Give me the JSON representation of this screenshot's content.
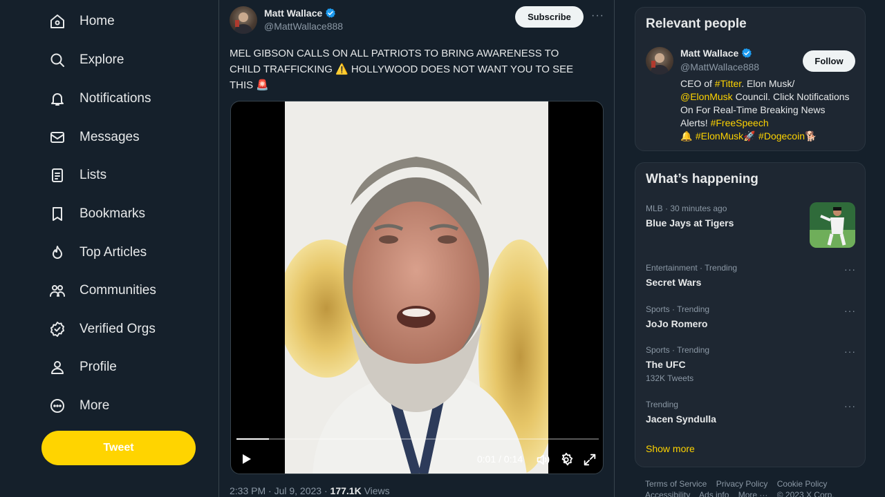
{
  "sidebar": {
    "items": [
      {
        "label": "Home",
        "icon": "home-icon"
      },
      {
        "label": "Explore",
        "icon": "search-icon"
      },
      {
        "label": "Notifications",
        "icon": "bell-icon"
      },
      {
        "label": "Messages",
        "icon": "mail-icon"
      },
      {
        "label": "Lists",
        "icon": "list-icon"
      },
      {
        "label": "Bookmarks",
        "icon": "bookmark-icon"
      },
      {
        "label": "Top Articles",
        "icon": "flame-icon"
      },
      {
        "label": "Communities",
        "icon": "people-icon"
      },
      {
        "label": "Verified Orgs",
        "icon": "verified-badge-icon"
      },
      {
        "label": "Profile",
        "icon": "person-icon"
      },
      {
        "label": "More",
        "icon": "more-circle-icon"
      }
    ],
    "tweet_label": "Tweet"
  },
  "post": {
    "author_name": "Matt Wallace",
    "author_handle": "@MattWallace888",
    "subscribe_label": "Subscribe",
    "more_label": "···",
    "text_line1": "MEL GIBSON CALLS ON ALL PATRIOTS TO BRING AWARENESS TO",
    "text_line2_a": "CHILD TRAFFICKING ",
    "text_line2_emoji": "⚠️",
    "text_line2_b": " HOLLYWOOD DOES NOT WANT YOU TO SEE",
    "text_line3_a": "THIS ",
    "text_line3_emoji": "🚨",
    "video": {
      "time_display": "0:01 / 0:14",
      "progress": 0.09
    },
    "meta_time": "2:33 PM · Jul 9, 2023 · ",
    "meta_views_count": "177.1K",
    "meta_views_label": " Views"
  },
  "relevant_people": {
    "title": "Relevant people",
    "name": "Matt Wallace",
    "handle": "@MattWallace888",
    "follow_label": "Follow",
    "bio_1": "CEO of ",
    "bio_hash1": "#Titter",
    "bio_2": ". Elon Musk/",
    "bio_mention": "@ElonMusk",
    "bio_3": " Council. Click Notifications On For Real-Time Breaking News Alerts! ",
    "bio_hash2": "#FreeSpeech",
    "bio_bell": "🔔 ",
    "bio_hash3": "#ElonMusk",
    "bio_rocket": "🚀 ",
    "bio_hash4": "#Dogecoin",
    "bio_dog": "🐕"
  },
  "whats_happening": {
    "title": "What’s happening",
    "trends": [
      {
        "meta": "MLB · 30 minutes ago",
        "title": "Blue Jays at Tigers",
        "sub": ""
      },
      {
        "meta": "Entertainment · Trending",
        "title": "Secret Wars",
        "sub": ""
      },
      {
        "meta": "Sports · Trending",
        "title": "JoJo Romero",
        "sub": ""
      },
      {
        "meta": "Sports · Trending",
        "title": "The UFC",
        "sub": "132K Tweets"
      },
      {
        "meta": "Trending",
        "title": "Jacen Syndulla",
        "sub": ""
      }
    ],
    "dots_label": "···",
    "show_more": "Show more"
  },
  "footer": {
    "links": [
      "Terms of Service",
      "Privacy Policy",
      "Cookie Policy",
      "Accessibility",
      "Ads info",
      "More ···",
      "© 2023 X Corp."
    ]
  },
  "colors": {
    "background": "#15202b",
    "accent": "#ffd400",
    "verified_blue": "#1d9bf0",
    "panel": "#1e2732",
    "muted_text": "#8b98a5"
  }
}
